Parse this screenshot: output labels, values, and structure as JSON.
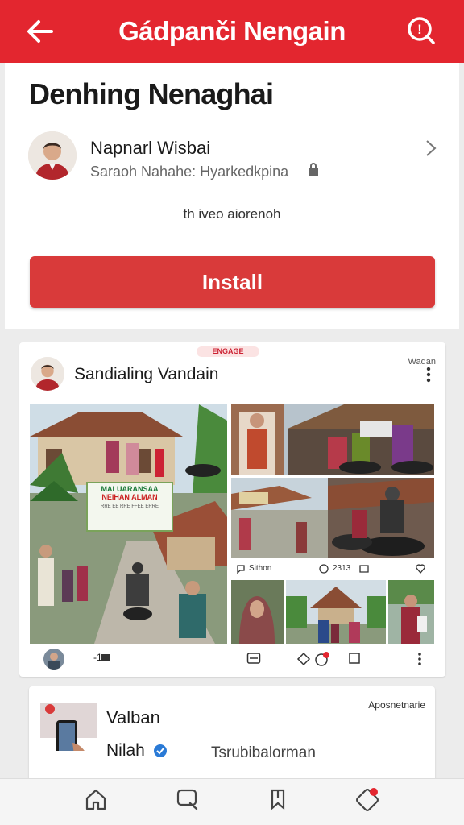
{
  "header": {
    "title": "Gádpanči Nengain",
    "back_icon": "arrow-left-icon",
    "help_icon": "help-icon",
    "color": "#e3262f"
  },
  "app": {
    "heading": "Denhing Nenaghai",
    "publisher_name": "Napnarl Wisbai",
    "publisher_sub": "Saraoh Nahahe: Hyarkedkpina",
    "info_line": "th iveo aiorenoh",
    "install_label": "Install",
    "install_color": "#d93a3a"
  },
  "post": {
    "tag": "ENGAGE",
    "author": "Sandialing Vandain",
    "meta": "Wadan",
    "banner_line1": "MALUARANSAA",
    "banner_line2": "NEIHAN ALMAN",
    "strip_left": "Sithon",
    "strip_mid": "2313",
    "footer_count": "-1",
    "banner_small": "RRE EE RRE FFEE ERRE"
  },
  "promo": {
    "name": "Valban",
    "sub": "Nilah",
    "right": "Tsrubibalorman",
    "top_right": "Aposnetnarie"
  },
  "nav": {
    "items": [
      "home-icon",
      "search-icon",
      "bookmark-icon",
      "notification-icon"
    ]
  }
}
